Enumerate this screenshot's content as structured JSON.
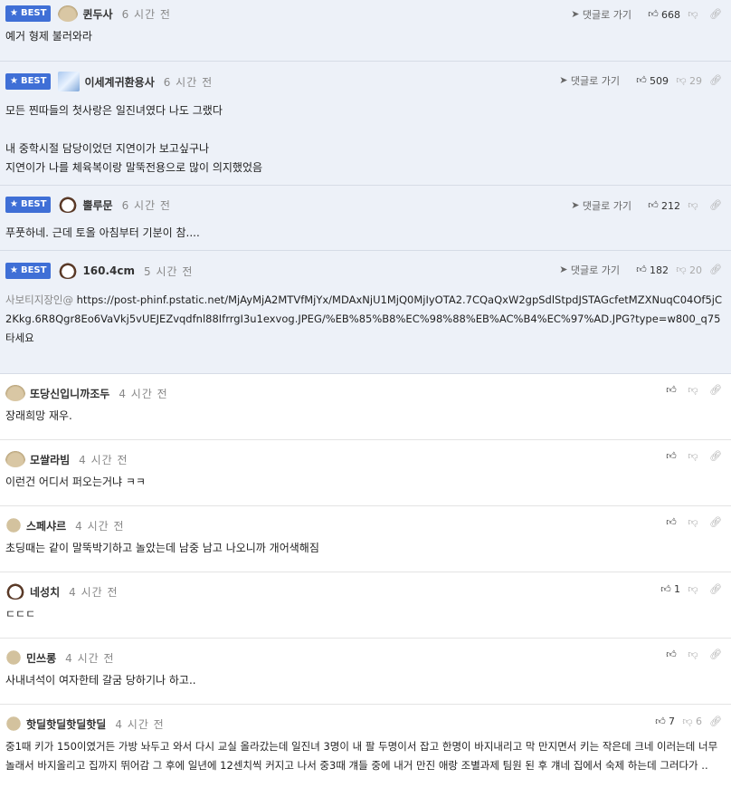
{
  "ui": {
    "goto_label": "댓글로 가기",
    "best_label": "BEST"
  },
  "comments": [
    {
      "nick": "퀸두사",
      "time": "6 시간 전",
      "up": "668",
      "down": "",
      "text": "예거 형제 불러와라"
    },
    {
      "nick": "이세계귀환용사",
      "time": "6 시간 전",
      "up": "509",
      "down": "29",
      "text1": "모든 찐따들의 첫사랑은 일진녀였다 나도 그랬다",
      "text2": "내 중학시절 담당이었던 지연이가 보고싶구나",
      "text3": "지연이가 나를 체육복이랑 말뚝전용으로 많이 의지했었음"
    },
    {
      "nick": "뿔루문",
      "time": "6 시간 전",
      "up": "212",
      "down": "",
      "text": "푸풋하네. 근데 토올 아침부터 기분이 참...."
    },
    {
      "nick": "160.4cm",
      "time": "5 시간 전",
      "up": "182",
      "down": "20",
      "prefix": "사보티지장인@",
      "url": "https://post-phinf.pstatic.net/MjAyMjA2MTVfMjYx/MDAxNjU1MjQ0MjIyOTA2.7CQaQxW2gpSdlStpdJSTAGcfetMZXNuqC04Of5jC2Kkg.6R8Qgr8Eo6VaVkj5vUEJEZvqdfnl88IfrrgI3u1exvog.JPEG/%EB%85%B8%EC%98%88%EB%AC%B4%EC%97%AD.JPG?type=w800_q75",
      "text": "타세요"
    },
    {
      "nick": "또당신입니까조두",
      "time": "4 시간 전",
      "up": "",
      "down": "",
      "text": "장래희망 재우."
    },
    {
      "nick": "모쌀라빔",
      "time": "4 시간 전",
      "up": "",
      "down": "",
      "text": "이런건 어디서 퍼오는거냐 ㅋㅋ"
    },
    {
      "nick": "스페샤르",
      "time": "4 시간 전",
      "up": "",
      "down": "",
      "text": "초딩때는 같이 말뚝박기하고 놀았는데 남중 남고 나오니까 개어색해짐"
    },
    {
      "nick": "네성치",
      "time": "4 시간 전",
      "up": "1",
      "down": "",
      "text": "ㄷㄷㄷ"
    },
    {
      "nick": "민쓰롱",
      "time": "4 시간 전",
      "up": "",
      "down": "",
      "text": "사내녀석이 여자한테 갈굼 당하기나 하고.."
    },
    {
      "nick": "핫딜핫딜핫딜핫딜",
      "time": "4 시간 전",
      "up": "7",
      "down": "6",
      "text": "중1때 키가 150이였거든 가방 놔두고 와서 다시 교실 올라갔는데 일진녀 3명이 내 팔 두명이서 잡고 한명이 바지내리고 막 만지면서 키는 작은데 크네 이러는데 너무 놀래서 바지올리고 집까지 뛰어감 그 후에 일년에 12센치씩 커지고 나서 중3때 걔들 중에 내거 만진 애랑 조별과제 팀원 된 후 걔네 집에서 숙제 하는데 그러다가 .."
    }
  ]
}
